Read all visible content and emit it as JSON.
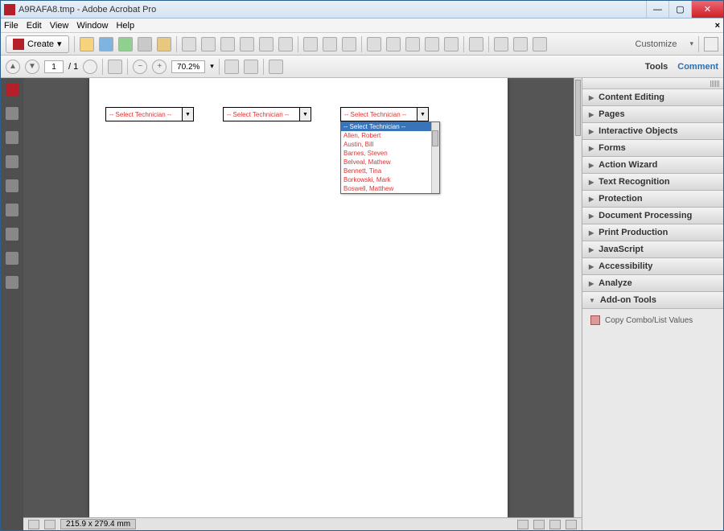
{
  "titlebar": {
    "title": "A9RAFA8.tmp - Adobe Acrobat Pro"
  },
  "menu": {
    "file": "File",
    "edit": "Edit",
    "view": "View",
    "window": "Window",
    "help": "Help"
  },
  "toolbar": {
    "create": "Create",
    "customize": "Customize"
  },
  "nav": {
    "page": "1",
    "total": "/ 1",
    "zoom": "70.2%"
  },
  "rightlinks": {
    "tools": "Tools",
    "comment": "Comment"
  },
  "status": {
    "dims": "215.9 x 279.4 mm"
  },
  "form": {
    "placeholder": "-- Select Technician --",
    "dropdown": {
      "selected": "-- Select Technician --",
      "options": [
        "Allen, Robert",
        "Austin, Bill",
        "Barnes, Steven",
        "Belveal, Mathew",
        "Bennett, Tina",
        "Borkowski, Mark",
        "Boswell, Matthew"
      ]
    }
  },
  "panel": {
    "sections": [
      "Content Editing",
      "Pages",
      "Interactive Objects",
      "Forms",
      "Action Wizard",
      "Text Recognition",
      "Protection",
      "Document Processing",
      "Print Production",
      "JavaScript",
      "Accessibility",
      "Analyze",
      "Add-on Tools"
    ],
    "addon_item": "Copy Combo/List Values"
  }
}
